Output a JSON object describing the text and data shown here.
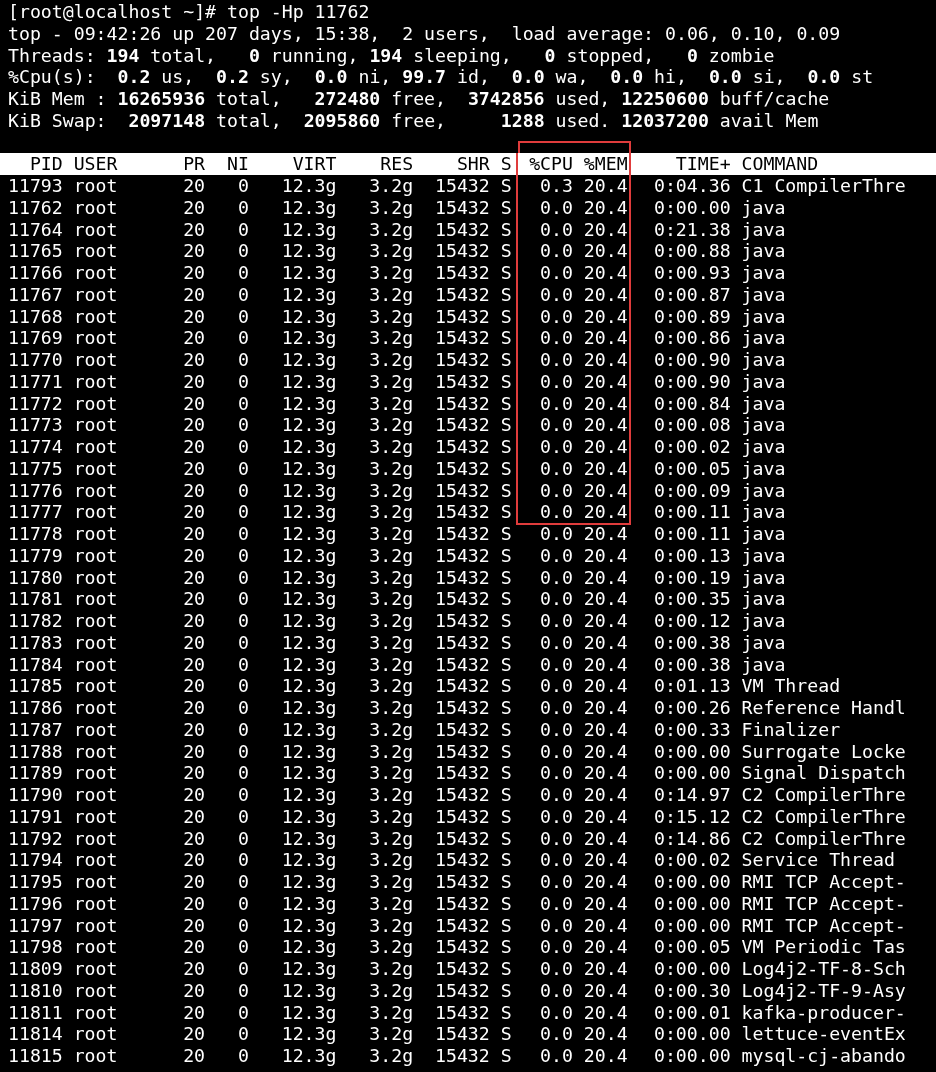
{
  "prompt": "[root@localhost ~]# top -Hp 11762",
  "summary": [
    "top - 09:42:26 up 207 days, 15:38,  2 users,  load average: 0.06, 0.10, 0.09",
    "Threads: **194** total,   **0** running, **194** sleeping,   **0** stopped,   **0** zombie",
    "%Cpu(s):  **0.2** us,  **0.2** sy,  **0.0** ni, **99.7** id,  **0.0** wa,  **0.0** hi,  **0.0** si,  **0.0** st",
    "KiB Mem : **16265936** total,   **272480** free,  **3742856** used, **12250600** buff/cache",
    "KiB Swap:  **2097148** total,  **2095860** free,     **1288** used. **12037200** avail Mem"
  ],
  "table": {
    "header_highlighted": true,
    "columns": [
      "PID",
      "USER",
      "PR",
      "NI",
      "VIRT",
      "RES",
      "SHR",
      "S",
      "%CPU",
      "%MEM",
      "TIME+",
      "COMMAND"
    ],
    "rows": [
      {
        "cells": [
          "11793",
          "root",
          "20",
          "0",
          "12.3g",
          "3.2g",
          "15432",
          "S",
          "0.3",
          "20.4",
          "0:04.36",
          "C1 CompilerThre"
        ],
        "highlighted": true
      },
      {
        "cells": [
          "11762",
          "root",
          "20",
          "0",
          "12.3g",
          "3.2g",
          "15432",
          "S",
          "0.0",
          "20.4",
          "0:00.00",
          "java"
        ],
        "highlighted": true
      },
      {
        "cells": [
          "11764",
          "root",
          "20",
          "0",
          "12.3g",
          "3.2g",
          "15432",
          "S",
          "0.0",
          "20.4",
          "0:21.38",
          "java"
        ],
        "highlighted": true
      },
      {
        "cells": [
          "11765",
          "root",
          "20",
          "0",
          "12.3g",
          "3.2g",
          "15432",
          "S",
          "0.0",
          "20.4",
          "0:00.88",
          "java"
        ],
        "highlighted": true
      },
      {
        "cells": [
          "11766",
          "root",
          "20",
          "0",
          "12.3g",
          "3.2g",
          "15432",
          "S",
          "0.0",
          "20.4",
          "0:00.93",
          "java"
        ],
        "highlighted": true
      },
      {
        "cells": [
          "11767",
          "root",
          "20",
          "0",
          "12.3g",
          "3.2g",
          "15432",
          "S",
          "0.0",
          "20.4",
          "0:00.87",
          "java"
        ],
        "highlighted": true
      },
      {
        "cells": [
          "11768",
          "root",
          "20",
          "0",
          "12.3g",
          "3.2g",
          "15432",
          "S",
          "0.0",
          "20.4",
          "0:00.89",
          "java"
        ],
        "highlighted": true
      },
      {
        "cells": [
          "11769",
          "root",
          "20",
          "0",
          "12.3g",
          "3.2g",
          "15432",
          "S",
          "0.0",
          "20.4",
          "0:00.86",
          "java"
        ],
        "highlighted": true
      },
      {
        "cells": [
          "11770",
          "root",
          "20",
          "0",
          "12.3g",
          "3.2g",
          "15432",
          "S",
          "0.0",
          "20.4",
          "0:00.90",
          "java"
        ],
        "highlighted": true
      },
      {
        "cells": [
          "11771",
          "root",
          "20",
          "0",
          "12.3g",
          "3.2g",
          "15432",
          "S",
          "0.0",
          "20.4",
          "0:00.90",
          "java"
        ],
        "highlighted": true
      },
      {
        "cells": [
          "11772",
          "root",
          "20",
          "0",
          "12.3g",
          "3.2g",
          "15432",
          "S",
          "0.0",
          "20.4",
          "0:00.84",
          "java"
        ],
        "highlighted": true
      },
      {
        "cells": [
          "11773",
          "root",
          "20",
          "0",
          "12.3g",
          "3.2g",
          "15432",
          "S",
          "0.0",
          "20.4",
          "0:00.08",
          "java"
        ],
        "highlighted": true
      },
      {
        "cells": [
          "11774",
          "root",
          "20",
          "0",
          "12.3g",
          "3.2g",
          "15432",
          "S",
          "0.0",
          "20.4",
          "0:00.02",
          "java"
        ],
        "highlighted": true
      },
      {
        "cells": [
          "11775",
          "root",
          "20",
          "0",
          "12.3g",
          "3.2g",
          "15432",
          "S",
          "0.0",
          "20.4",
          "0:00.05",
          "java"
        ],
        "highlighted": true
      },
      {
        "cells": [
          "11776",
          "root",
          "20",
          "0",
          "12.3g",
          "3.2g",
          "15432",
          "S",
          "0.0",
          "20.4",
          "0:00.09",
          "java"
        ],
        "highlighted": true
      },
      {
        "cells": [
          "11777",
          "root",
          "20",
          "0",
          "12.3g",
          "3.2g",
          "15432",
          "S",
          "0.0",
          "20.4",
          "0:00.11",
          "java"
        ],
        "highlighted": true
      },
      {
        "cells": [
          "11778",
          "root",
          "20",
          "0",
          "12.3g",
          "3.2g",
          "15432",
          "S",
          "0.0",
          "20.4",
          "0:00.11",
          "java"
        ],
        "highlighted": false
      },
      {
        "cells": [
          "11779",
          "root",
          "20",
          "0",
          "12.3g",
          "3.2g",
          "15432",
          "S",
          "0.0",
          "20.4",
          "0:00.13",
          "java"
        ],
        "highlighted": false
      },
      {
        "cells": [
          "11780",
          "root",
          "20",
          "0",
          "12.3g",
          "3.2g",
          "15432",
          "S",
          "0.0",
          "20.4",
          "0:00.19",
          "java"
        ],
        "highlighted": false
      },
      {
        "cells": [
          "11781",
          "root",
          "20",
          "0",
          "12.3g",
          "3.2g",
          "15432",
          "S",
          "0.0",
          "20.4",
          "0:00.35",
          "java"
        ],
        "highlighted": false
      },
      {
        "cells": [
          "11782",
          "root",
          "20",
          "0",
          "12.3g",
          "3.2g",
          "15432",
          "S",
          "0.0",
          "20.4",
          "0:00.12",
          "java"
        ],
        "highlighted": false
      },
      {
        "cells": [
          "11783",
          "root",
          "20",
          "0",
          "12.3g",
          "3.2g",
          "15432",
          "S",
          "0.0",
          "20.4",
          "0:00.38",
          "java"
        ],
        "highlighted": false
      },
      {
        "cells": [
          "11784",
          "root",
          "20",
          "0",
          "12.3g",
          "3.2g",
          "15432",
          "S",
          "0.0",
          "20.4",
          "0:00.38",
          "java"
        ],
        "highlighted": false
      },
      {
        "cells": [
          "11785",
          "root",
          "20",
          "0",
          "12.3g",
          "3.2g",
          "15432",
          "S",
          "0.0",
          "20.4",
          "0:01.13",
          "VM Thread"
        ],
        "highlighted": false
      },
      {
        "cells": [
          "11786",
          "root",
          "20",
          "0",
          "12.3g",
          "3.2g",
          "15432",
          "S",
          "0.0",
          "20.4",
          "0:00.26",
          "Reference Handl"
        ],
        "highlighted": false
      },
      {
        "cells": [
          "11787",
          "root",
          "20",
          "0",
          "12.3g",
          "3.2g",
          "15432",
          "S",
          "0.0",
          "20.4",
          "0:00.33",
          "Finalizer"
        ],
        "highlighted": false
      },
      {
        "cells": [
          "11788",
          "root",
          "20",
          "0",
          "12.3g",
          "3.2g",
          "15432",
          "S",
          "0.0",
          "20.4",
          "0:00.00",
          "Surrogate Locke"
        ],
        "highlighted": false
      },
      {
        "cells": [
          "11789",
          "root",
          "20",
          "0",
          "12.3g",
          "3.2g",
          "15432",
          "S",
          "0.0",
          "20.4",
          "0:00.00",
          "Signal Dispatch"
        ],
        "highlighted": false
      },
      {
        "cells": [
          "11790",
          "root",
          "20",
          "0",
          "12.3g",
          "3.2g",
          "15432",
          "S",
          "0.0",
          "20.4",
          "0:14.97",
          "C2 CompilerThre"
        ],
        "highlighted": false
      },
      {
        "cells": [
          "11791",
          "root",
          "20",
          "0",
          "12.3g",
          "3.2g",
          "15432",
          "S",
          "0.0",
          "20.4",
          "0:15.12",
          "C2 CompilerThre"
        ],
        "highlighted": false
      },
      {
        "cells": [
          "11792",
          "root",
          "20",
          "0",
          "12.3g",
          "3.2g",
          "15432",
          "S",
          "0.0",
          "20.4",
          "0:14.86",
          "C2 CompilerThre"
        ],
        "highlighted": false
      },
      {
        "cells": [
          "11794",
          "root",
          "20",
          "0",
          "12.3g",
          "3.2g",
          "15432",
          "S",
          "0.0",
          "20.4",
          "0:00.02",
          "Service Thread"
        ],
        "highlighted": false
      },
      {
        "cells": [
          "11795",
          "root",
          "20",
          "0",
          "12.3g",
          "3.2g",
          "15432",
          "S",
          "0.0",
          "20.4",
          "0:00.00",
          "RMI TCP Accept-"
        ],
        "highlighted": false
      },
      {
        "cells": [
          "11796",
          "root",
          "20",
          "0",
          "12.3g",
          "3.2g",
          "15432",
          "S",
          "0.0",
          "20.4",
          "0:00.00",
          "RMI TCP Accept-"
        ],
        "highlighted": false
      },
      {
        "cells": [
          "11797",
          "root",
          "20",
          "0",
          "12.3g",
          "3.2g",
          "15432",
          "S",
          "0.0",
          "20.4",
          "0:00.00",
          "RMI TCP Accept-"
        ],
        "highlighted": false
      },
      {
        "cells": [
          "11798",
          "root",
          "20",
          "0",
          "12.3g",
          "3.2g",
          "15432",
          "S",
          "0.0",
          "20.4",
          "0:00.05",
          "VM Periodic Tas"
        ],
        "highlighted": false
      },
      {
        "cells": [
          "11809",
          "root",
          "20",
          "0",
          "12.3g",
          "3.2g",
          "15432",
          "S",
          "0.0",
          "20.4",
          "0:00.00",
          "Log4j2-TF-8-Sch"
        ],
        "highlighted": false
      },
      {
        "cells": [
          "11810",
          "root",
          "20",
          "0",
          "12.3g",
          "3.2g",
          "15432",
          "S",
          "0.0",
          "20.4",
          "0:00.30",
          "Log4j2-TF-9-Asy"
        ],
        "highlighted": false
      },
      {
        "cells": [
          "11811",
          "root",
          "20",
          "0",
          "12.3g",
          "3.2g",
          "15432",
          "S",
          "0.0",
          "20.4",
          "0:00.01",
          "kafka-producer-"
        ],
        "highlighted": false
      },
      {
        "cells": [
          "11814",
          "root",
          "20",
          "0",
          "12.3g",
          "3.2g",
          "15432",
          "S",
          "0.0",
          "20.4",
          "0:00.00",
          "lettuce-eventEx"
        ],
        "highlighted": false
      },
      {
        "cells": [
          "11815",
          "root",
          "20",
          "0",
          "12.3g",
          "3.2g",
          "15432",
          "S",
          "0.0",
          "20.4",
          "0:00.00",
          "mysql-cj-abando"
        ],
        "highlighted": false
      }
    ]
  }
}
